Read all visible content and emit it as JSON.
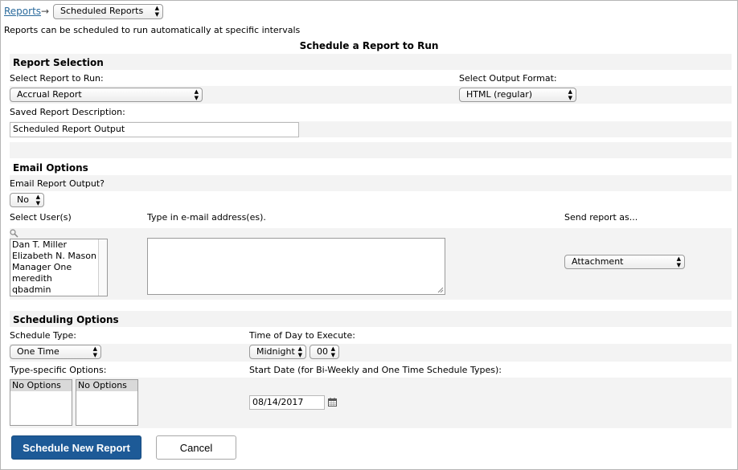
{
  "breadcrumb": {
    "link": "Reports",
    "arrow": "→",
    "current": "Scheduled Reports"
  },
  "intro": "Reports can be scheduled to run automatically at specific intervals",
  "page_title": "Schedule a Report to Run",
  "report_selection": {
    "heading": "Report Selection",
    "select_report_label": "Select Report to Run:",
    "select_report_value": "Accrual Report",
    "output_format_label": "Select Output Format:",
    "output_format_value": "HTML (regular)",
    "description_label": "Saved Report Description:",
    "description_value": "Scheduled Report Output"
  },
  "email_options": {
    "heading": "Email Options",
    "email_output_label": "Email Report Output?",
    "email_output_value": "No",
    "select_users_label": "Select User(s)",
    "users": [
      "Dan T. Miller",
      "Elizabeth N. Mason",
      "Manager One",
      "meredith",
      "qbadmin"
    ],
    "emails_label": "Type in e-mail address(es).",
    "emails_value": "",
    "send_as_label": "Send report as...",
    "send_as_value": "Attachment"
  },
  "scheduling_options": {
    "heading": "Scheduling Options",
    "schedule_type_label": "Schedule Type:",
    "schedule_type_value": "One Time",
    "time_label": "Time of Day to Execute:",
    "time_hour": "Midnight",
    "time_minute": "00",
    "type_specific_label": "Type-specific Options:",
    "type_specific_list1": [
      "No Options"
    ],
    "type_specific_list2": [
      "No Options"
    ],
    "start_date_label": "Start Date (for Bi-Weekly and One Time Schedule Types):",
    "start_date_value": "08/14/2017"
  },
  "actions": {
    "schedule_button": "Schedule New Report",
    "cancel_button": "Cancel"
  },
  "colors": {
    "primary_button": "#1d5a97",
    "band_background": "#f3f3f3",
    "link": "#2a6a9c"
  },
  "icons": {
    "search": "magnifier-icon",
    "calendar": "calendar-icon",
    "select_arrows": "up-down-arrows"
  }
}
